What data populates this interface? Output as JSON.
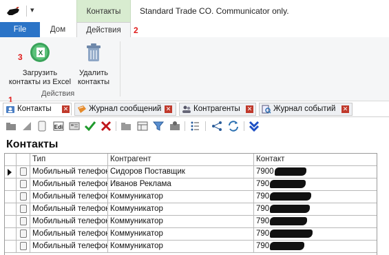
{
  "window": {
    "title": "Standard Trade CO. Communicator only."
  },
  "ribbon": {
    "contextual_tab": "Контакты",
    "tabs": {
      "file": "File",
      "home": "Дом",
      "actions": "Действия"
    },
    "buttons": {
      "import_excel": "Загрузить контакты из Excel",
      "delete_contacts": "Удалить контакты"
    },
    "group_label": "Действия"
  },
  "annotations": {
    "marker_1": "1",
    "marker_2": "2",
    "marker_3": "3"
  },
  "doc_tabs": [
    {
      "label": "Контакты",
      "icon": "contacts-icon",
      "active": true
    },
    {
      "label": "Журнал сообщений",
      "icon": "messages-log-icon",
      "active": false
    },
    {
      "label": "Контрагенты",
      "icon": "counterparties-icon",
      "active": false
    },
    {
      "label": "Журнал событий",
      "icon": "events-log-icon",
      "active": false
    }
  ],
  "toolbar_icons": [
    "add-folder-icon",
    "edit-triangle-icon",
    "document-icon",
    "edit-text-icon",
    "card-icon",
    "check-icon",
    "cross-icon",
    "folder-icon",
    "view-icon",
    "filter-icon",
    "group-icon",
    "list-settings-icon",
    "tree-icon",
    "refresh-icon",
    "expand-down-icon"
  ],
  "page": {
    "heading": "Контакты"
  },
  "grid": {
    "columns": [
      "Тип",
      "Контрагент",
      "Контакт"
    ],
    "rows": [
      {
        "type": "Мобильный телефон",
        "counterparty": "Сидоров Поставщик",
        "contact": "7900"
      },
      {
        "type": "Мобильный телефон",
        "counterparty": "Иванов Реклама",
        "contact": "790"
      },
      {
        "type": "Мобильный телефон",
        "counterparty": "Коммуникатор",
        "contact": "790"
      },
      {
        "type": "Мобильный телефон",
        "counterparty": "Коммуникатор",
        "contact": "790"
      },
      {
        "type": "Мобильный телефон",
        "counterparty": "Коммуникатор",
        "contact": "790"
      },
      {
        "type": "Мобильный телефон",
        "counterparty": "Коммуникатор",
        "contact": "790"
      },
      {
        "type": "Мобильный телефон",
        "counterparty": "Коммуникатор",
        "contact": "790"
      }
    ]
  },
  "colors": {
    "file_tab": "#2b74c7",
    "contextual_tab": "#d8ecd0",
    "annotation": "#e01a1a"
  }
}
